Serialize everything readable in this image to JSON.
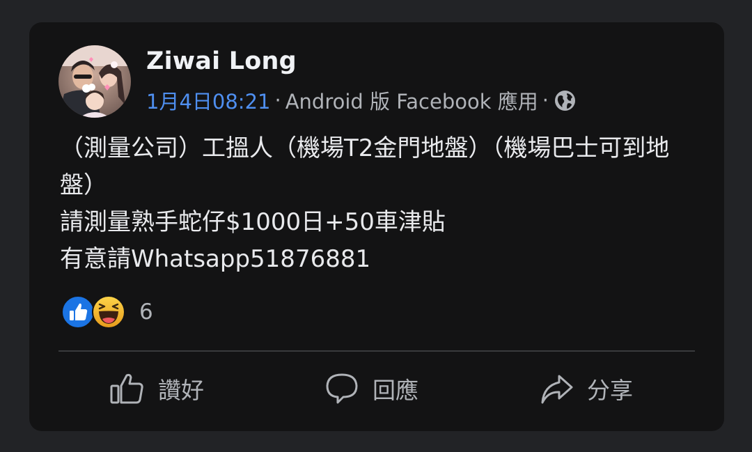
{
  "post": {
    "author": "Ziwai Long",
    "timestamp": "1月4日08:21",
    "separator": "·",
    "source": "Android 版 Facebook 應用",
    "privacy_icon": "globe-icon",
    "text_lines": [
      "（測量公司）工搵人（機場T2金門地盤）（機場巴士可到地盤）",
      "請測量熟手蛇仔$1000日+50車津貼",
      "有意請Whatsapp51876881"
    ]
  },
  "reactions": {
    "icons": [
      "like-reaction-icon",
      "haha-reaction-icon"
    ],
    "count": "6"
  },
  "actions": {
    "like_label": "讚好",
    "comment_label": "回應",
    "share_label": "分享"
  },
  "colors": {
    "page_bg": "#222326",
    "card_bg": "#131314",
    "timestamp": "#4f8ff0",
    "like_blue": "#1b74e4",
    "haha_yellow": "#f2b22c"
  }
}
